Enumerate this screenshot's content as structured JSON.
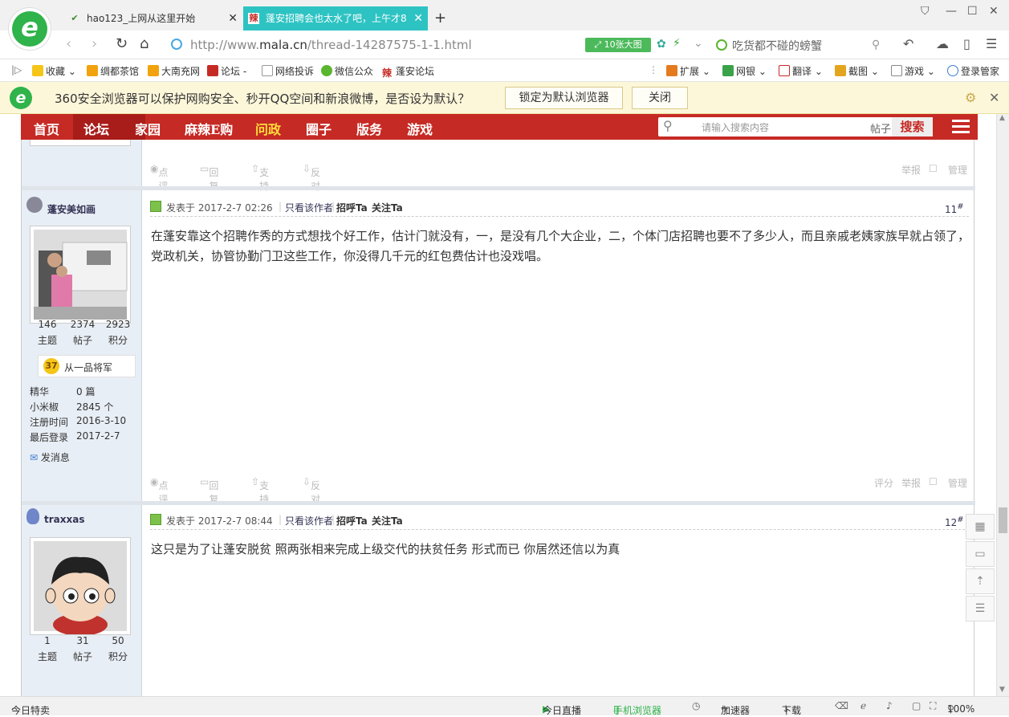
{
  "browser": {
    "tabs": [
      {
        "label": "hao123_上网从这里开始",
        "active": false
      },
      {
        "label": "蓬安招聘会也太水了吧，上午才8",
        "active": true
      }
    ],
    "url_prefix": "http://www.",
    "url_domain": "mala.cn",
    "url_path": "/thread-14287575-1-1.html",
    "ten_pics_label": "10张大图",
    "search_hint": "吃货都不碰的螃蟹",
    "bookmarks": [
      "收藏",
      "绸都茶馆",
      "大南充网",
      "论坛 -",
      "网络投诉",
      "微信公众",
      "蓬安论坛"
    ],
    "bookmark_right": [
      "扩展",
      "网银",
      "翻译",
      "截图",
      "游戏",
      "登录管家"
    ],
    "infobar": {
      "text": "360安全浏览器可以保护网购安全、秒开QQ空间和新浪微博，是否设为默认？",
      "lock_btn": "锁定为默认浏览器",
      "close_btn": "关闭"
    },
    "status": {
      "left": "今日特卖",
      "live": "今日直播",
      "mobile": "手机浏览器",
      "accel": "加速器",
      "download": "下载",
      "zoom": "100%"
    }
  },
  "site": {
    "nav": [
      "首页",
      "论坛",
      "家园",
      "麻辣E购",
      "问政",
      "圈子",
      "版务",
      "游戏"
    ],
    "search_placeholder": "请输入搜索内容",
    "search_scope": "帖子",
    "search_btn": "搜索"
  },
  "actions": {
    "comment": "点评",
    "reply": "回复",
    "support": "支持",
    "oppose": "反对",
    "rate": "评分",
    "report": "举报",
    "manage": "管理"
  },
  "posts": [
    {
      "user": "蓬安美如画",
      "topics": "146",
      "posts": "2374",
      "credits": "2923",
      "topics_label": "主题",
      "posts_label": "帖子",
      "credits_label": "积分",
      "level": "37",
      "rank": "从一品将军",
      "jinghua_label": "精华",
      "jinghua": "0 篇",
      "pepper_label": "小米椒",
      "pepper": "2845 个",
      "reg_label": "注册时间",
      "reg": "2016-3-10",
      "last_label": "最后登录",
      "last": "2017-2-7",
      "msg": "发消息",
      "posted_at": "发表于 2017-2-7 02:26",
      "only_author": "只看该作者",
      "greet": "招呼Ta",
      "follow": "关注Ta",
      "floor": "11",
      "content": "在蓬安靠这个招聘作秀的方式想找个好工作，估计门就没有，一，是没有几个大企业，二，个体门店招聘也要不了多少人，而且亲戚老姨家族早就占领了，党政机关，协管协勤门卫这些工作，你没得几千元的红包费估计也没戏唱。"
    },
    {
      "user": "traxxas",
      "topics": "1",
      "posts": "31",
      "credits": "50",
      "topics_label": "主题",
      "posts_label": "帖子",
      "credits_label": "积分",
      "posted_at": "发表于 2017-2-7 08:44",
      "only_author": "只看该作者",
      "greet": "招呼Ta",
      "follow": "关注Ta",
      "floor": "12",
      "content": "这只是为了让蓬安脱贫 照两张相来完成上级交代的扶贫任务 形式而已 你居然还信以为真"
    }
  ]
}
